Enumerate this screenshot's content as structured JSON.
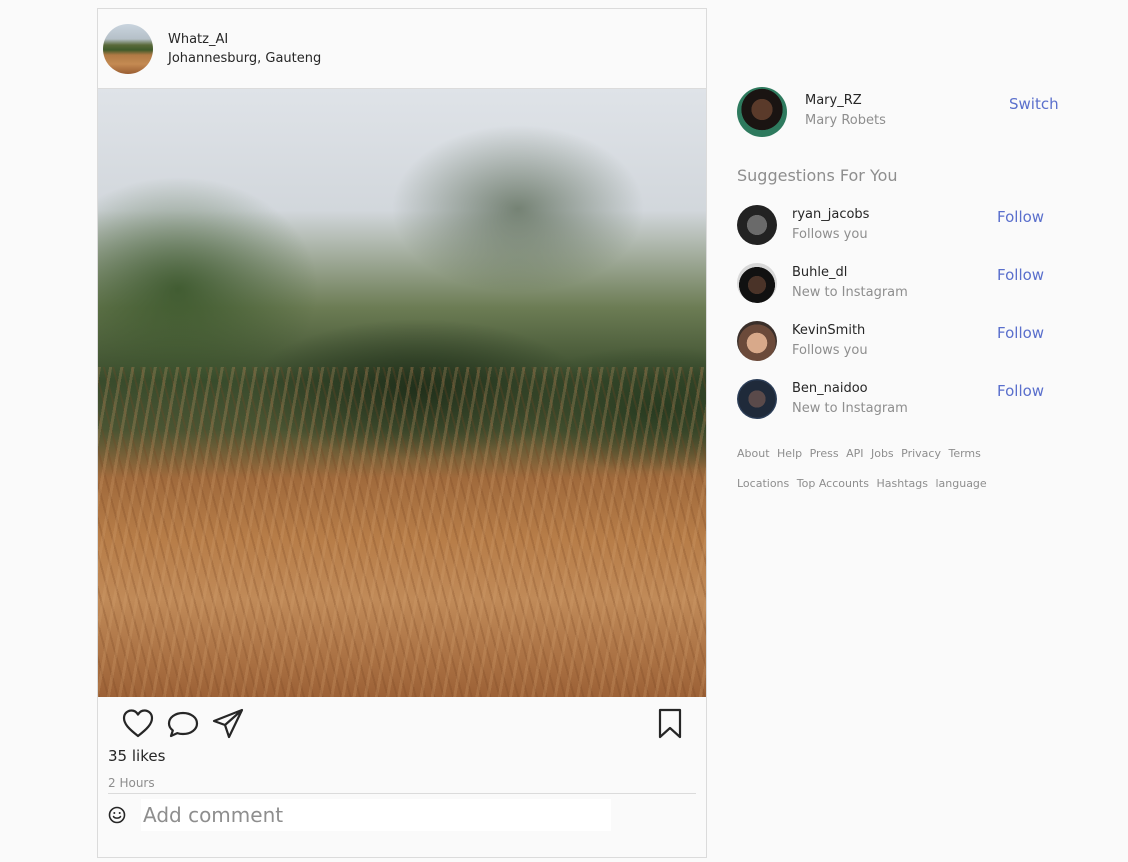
{
  "post": {
    "username": "Whatz_AI",
    "location": "Johannesburg, Gauteng",
    "likes": "35 likes",
    "time": "2 Hours",
    "comment_placeholder": "Add comment"
  },
  "current_user": {
    "username": "Mary_RZ",
    "full_name": "Mary Robets",
    "switch_label": "Switch"
  },
  "suggestions": {
    "title": "Suggestions For You",
    "items": [
      {
        "username": "ryan_jacobs",
        "subtitle": "Follows you",
        "action": "Follow"
      },
      {
        "username": "Buhle_dl",
        "subtitle": "New to Instagram",
        "action": "Follow"
      },
      {
        "username": "KevinSmith",
        "subtitle": "Follows you",
        "action": "Follow"
      },
      {
        "username": "Ben_naidoo",
        "subtitle": "New to Instagram",
        "action": "Follow"
      }
    ]
  },
  "footer": {
    "row1": [
      "About",
      "Help",
      "Press",
      "API",
      "Jobs",
      "Privacy",
      "Terms"
    ],
    "row2": [
      "Locations",
      "Top Accounts",
      "Hashtags",
      "language"
    ]
  },
  "colors": {
    "accent": "#5a6fcc",
    "muted": "#8e8e8e",
    "border": "#dbdbdb"
  },
  "icons": [
    "heart-icon",
    "comment-icon",
    "share-icon",
    "bookmark-icon",
    "smile-icon"
  ]
}
